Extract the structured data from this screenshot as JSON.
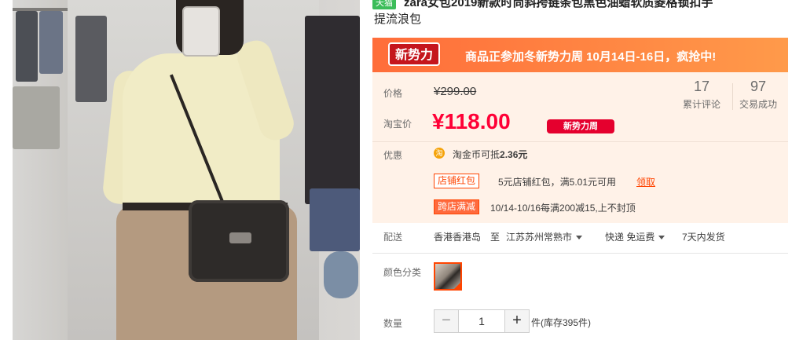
{
  "title": {
    "tag": "天猫",
    "line1": "zara女包2019新款时尚斜挎链条包黑色油蜡软质菱格锁扣手",
    "line2": "提流浪包"
  },
  "promo": {
    "badge": "新势力周",
    "text": "商品正参加冬新势力周 10月14日-16日，疯抢中!",
    "colors": {
      "start": "#ff6d3a",
      "end": "#ff9a4a",
      "badge": "#c5161d"
    }
  },
  "price": {
    "label_price": "价格",
    "original": "¥299.00",
    "label_taobao": "淘宝价",
    "current": "¥118.00",
    "tag": "新势力周",
    "accent_color": "#ff0036"
  },
  "stats": [
    {
      "value": "17",
      "label": "累计评论"
    },
    {
      "value": "97",
      "label": "交易成功"
    }
  ],
  "offers": {
    "label": "优惠",
    "coin_icon": "淘",
    "coin_text_prefix": "淘金币可抵",
    "coin_amount": "2.36元",
    "shop_coupon_tag": "店铺红包",
    "shop_coupon_text": "5元店铺红包，满5.01元可用",
    "shop_coupon_link": "领取",
    "cross_shop_tag": "跨店满减",
    "cross_shop_text": "10/14-10/16每满200减15,上不封顶"
  },
  "shipping": {
    "label": "配送",
    "from": "香港香港岛",
    "to_word": "至",
    "to": "江苏苏州常熟市",
    "method": "快递 免运费",
    "time": "7天内发货"
  },
  "color": {
    "label": "颜色分类",
    "selected_icon": "bag-thumbnail-icon"
  },
  "quantity": {
    "label": "数量",
    "minus": "−",
    "value": "1",
    "plus": "+",
    "stock": "件(库存395件)"
  }
}
